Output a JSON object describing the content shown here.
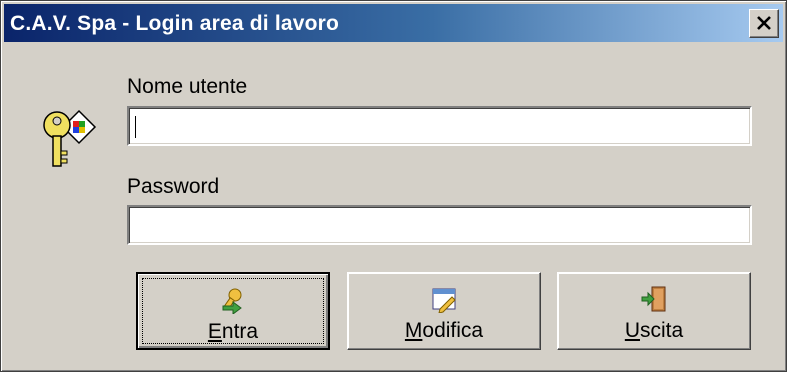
{
  "window": {
    "title": "C.A.V. Spa - Login area di lavoro"
  },
  "icons": {
    "close": "close-icon",
    "keys": "keys-icon",
    "entra": "entra-icon",
    "modifica": "modifica-icon",
    "uscita": "uscita-icon"
  },
  "form": {
    "username": {
      "label": "Nome utente",
      "value": "",
      "placeholder": ""
    },
    "password": {
      "label": "Password",
      "value": "",
      "placeholder": ""
    }
  },
  "buttons": {
    "entra": {
      "first": "E",
      "rest": "ntra"
    },
    "modifica": {
      "first": "M",
      "rest": "odifica"
    },
    "uscita": {
      "first": "U",
      "rest": "scita"
    }
  },
  "colors": {
    "titlebar_start": "#0a246a",
    "titlebar_end": "#a6caf0",
    "face": "#d4d0c8"
  }
}
